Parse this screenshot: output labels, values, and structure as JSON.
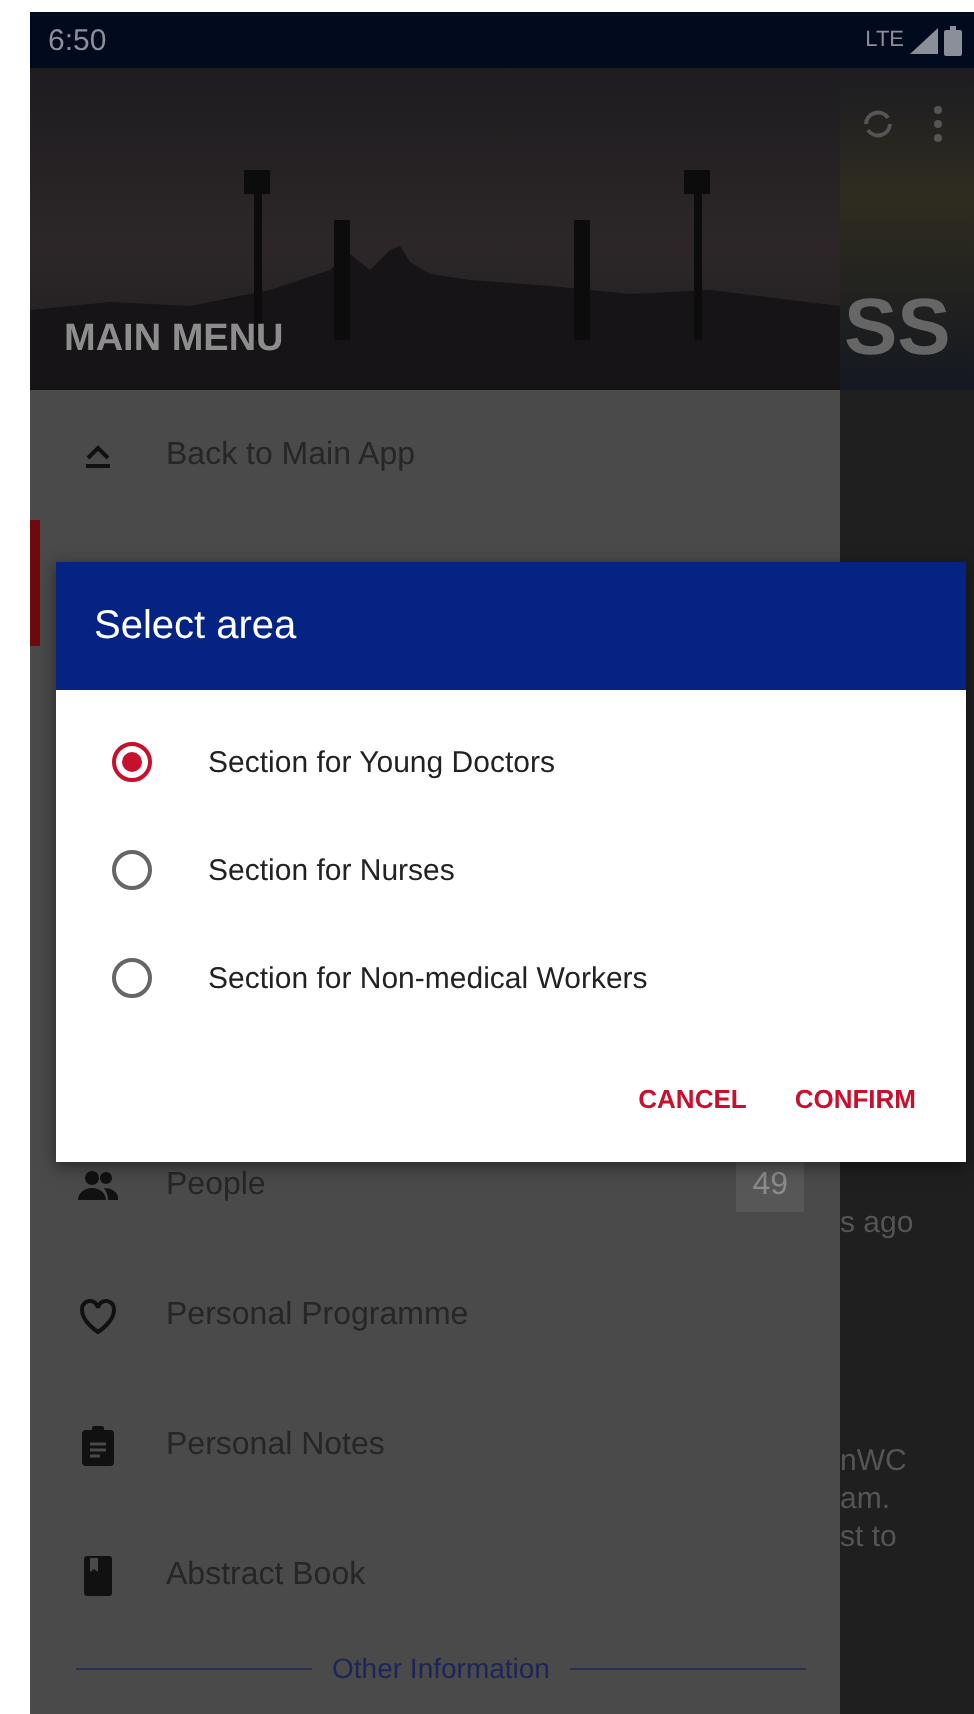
{
  "status_bar": {
    "time": "6:50",
    "network": "LTE"
  },
  "drawer": {
    "title": "MAIN MENU",
    "back_item": {
      "label": "Back to Main App"
    },
    "items": [
      {
        "kind": "people",
        "label": "People",
        "count": "49"
      },
      {
        "kind": "heart",
        "label": "Personal Programme"
      },
      {
        "kind": "clipboard",
        "label": "Personal Notes"
      },
      {
        "kind": "book",
        "label": "Abstract Book"
      }
    ],
    "section_divider": "Other Information"
  },
  "background_content": {
    "heading": "SS",
    "texts": [
      "s ago",
      "nWC",
      "am.",
      "st to"
    ]
  },
  "dialog": {
    "title": "Select area",
    "options": [
      {
        "label": "Section for Young Doctors",
        "selected": true
      },
      {
        "label": "Section for Nurses",
        "selected": false
      },
      {
        "label": "Section for Non-medical Workers",
        "selected": false
      }
    ],
    "buttons": [
      "CANCEL",
      "CONFIRM"
    ]
  }
}
